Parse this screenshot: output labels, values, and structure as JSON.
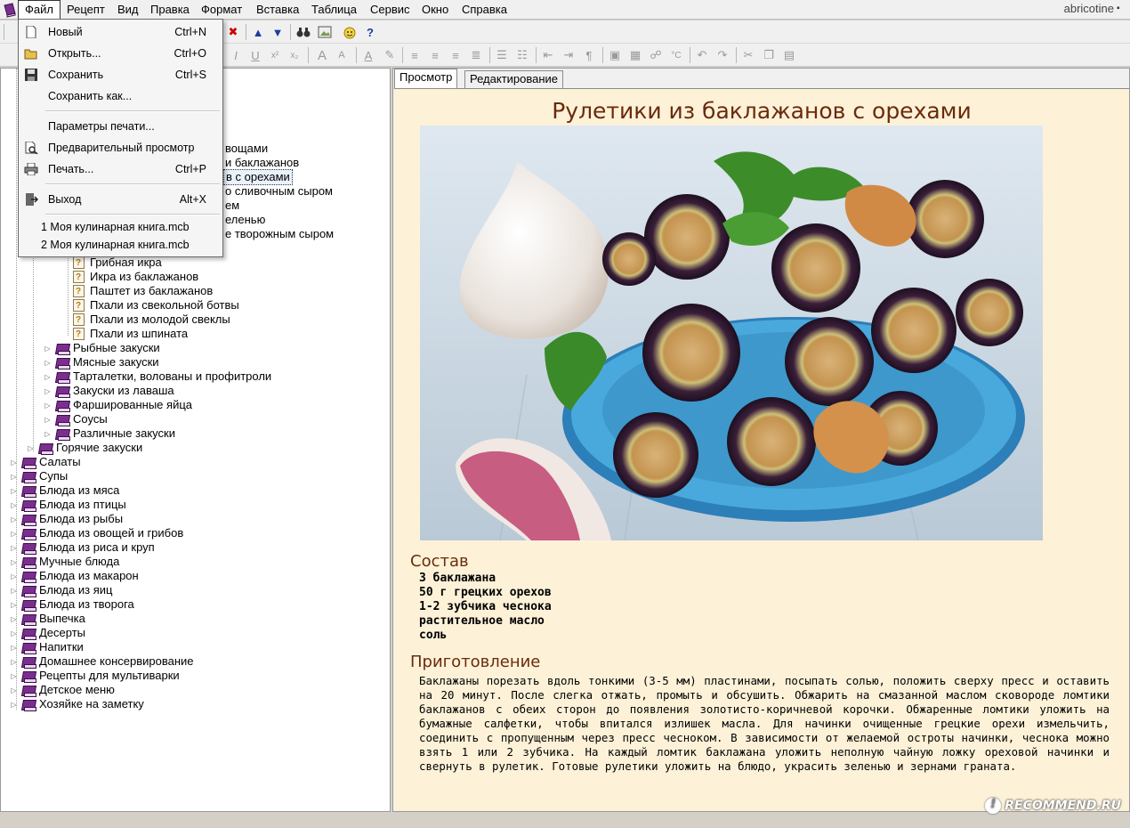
{
  "menubar": {
    "items": [
      "Файл",
      "Рецепт",
      "Вид",
      "Правка",
      "Формат",
      "Вставка",
      "Таблица",
      "Сервис",
      "Окно",
      "Справка"
    ],
    "brand": "abricotine"
  },
  "file_menu": {
    "items": [
      {
        "label": "Новый",
        "shortcut": "Ctrl+N",
        "icon": "new-document-icon"
      },
      {
        "label": "Открыть...",
        "shortcut": "Ctrl+O",
        "icon": "open-folder-icon"
      },
      {
        "label": "Сохранить",
        "shortcut": "Ctrl+S",
        "icon": "save-disk-icon"
      },
      {
        "label": "Сохранить как...",
        "shortcut": "",
        "icon": ""
      },
      {
        "label": "Параметры печати...",
        "shortcut": "",
        "icon": ""
      },
      {
        "label": "Предварительный просмотр",
        "shortcut": "",
        "icon": "print-preview-icon"
      },
      {
        "label": "Печать...",
        "shortcut": "Ctrl+P",
        "icon": "printer-icon"
      },
      {
        "label": "Выход",
        "shortcut": "Alt+X",
        "icon": "exit-door-icon"
      }
    ],
    "recent": [
      "1 Моя кулинарная книга.mcb",
      "2 Моя кулинарная книга.mcb"
    ]
  },
  "tree": {
    "partial_items": [
      "вощами",
      "и баклажанов",
      "в с орехами",
      "о сливочным сыром",
      "ем",
      "еленью",
      "е творожным сыром"
    ],
    "recipes": [
      "Грибная икра",
      "Икра из баклажанов",
      "Паштет из баклажанов",
      "Пхали из свекольной ботвы",
      "Пхали из молодой свеклы",
      "Пхали из шпината"
    ],
    "subcategories": [
      "Рыбные закуски",
      "Мясные закуски",
      "Тарталетки, волованы и профитроли",
      "Закуски из лаваша",
      "Фаршированные яйца",
      "Соусы",
      "Различные закуски"
    ],
    "hot": "Горячие закуски",
    "categories": [
      "Салаты",
      "Супы",
      "Блюда из мяса",
      "Блюда из птицы",
      "Блюда из рыбы",
      "Блюда из овощей и грибов",
      "Блюда из риса и круп",
      "Мучные блюда",
      "Блюда из макарон",
      "Блюда из яиц",
      "Блюда из творога",
      "Выпечка",
      "Десерты",
      "Напитки",
      "Домашнее консервирование",
      "Рецепты для мультиварки",
      "Детское меню",
      "Хозяйке на заметку"
    ]
  },
  "tabs": [
    "Просмотр",
    "Редактирование"
  ],
  "recipe": {
    "title": "Рулетики из баклажанов с орехами",
    "ingredients_heading": "Состав",
    "ingredients": [
      "3 баклажана",
      "50 г грецких орехов",
      "1-2 зубчика чеснока",
      "растительное масло",
      "соль"
    ],
    "prep_heading": "Приготовление",
    "prep_text": "Баклажаны порезать вдоль тонкими (3-5 мм) пластинами, посыпать солью, положить сверху пресс и оставить на 20 минут. После слегка отжать, промыть и обсушить. Обжарить на смазанной маслом сковороде ломтики баклажанов с обеих сторон до появления золотисто-коричневой корочки. Обжаренные ломтики уложить на бумажные салфетки, чтобы впитался излишек масла. Для начинки очищенные грецкие орехи измельчить, соединить с пропущенным через пресс чесноком. В зависимости от желаемой остроты начинки, чеснока можно взять 1 или 2 зубчика. На каждый ломтик баклажана уложить неполную чайную ложку ореховой начинки и свернуть в рулетик. Готовые рулетики уложить на блюдо, украсить зеленью и зернами граната."
  },
  "watermark": "RECOMMEND.RU",
  "colors": {
    "heading": "#6b2a0c",
    "content_bg": "#fdf2d8",
    "book_icon": "#7a2f8e"
  }
}
